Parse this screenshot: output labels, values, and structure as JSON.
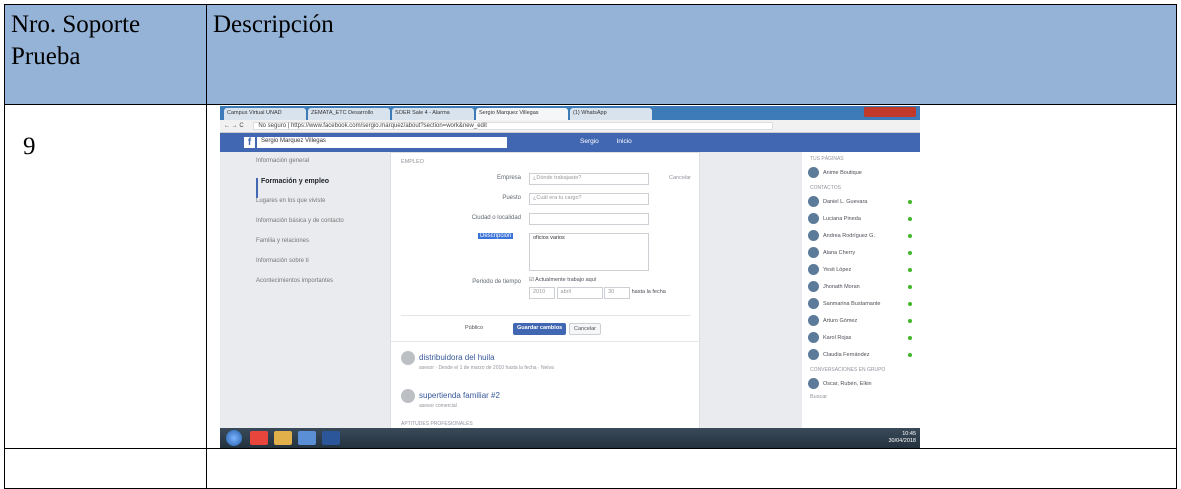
{
  "table": {
    "header_col1": "Nro. Soporte\nPrueba",
    "header_col2": "Descripción",
    "row_number": "9"
  },
  "screenshot": {
    "browser_tabs": [
      "Campus Virtual UNAD",
      "ZEMATA_ETC Desarrollo",
      "SOER Sale 4 - Alarma",
      "Sergio Marquez Villegas",
      "(1) WhatsApp"
    ],
    "address_security": "No seguro",
    "address_url": "https://www.facebook.com/sergio.marquez/about?section=work&new_edit",
    "search_value": "Sergio Marquez Villegas",
    "header_user": "Sergio",
    "header_inicio": "Inicio",
    "left_nav": [
      "Información general",
      "Formación y empleo",
      "Lugares en los que viviste",
      "Información básica y de contacto",
      "Familia y relaciones",
      "Información sobre ti",
      "Acontecimientos importantes"
    ],
    "section_label": "EMPLEO",
    "cancel_top": "Cancelar",
    "fields": {
      "empresa_label": "Empresa",
      "empresa_placeholder": "¿Dónde trabajaste?",
      "puesto_label": "Puesto",
      "puesto_placeholder": "¿Cuál era tu cargo?",
      "ciudad_label": "Ciudad o localidad",
      "descripcion_label": "Descripción",
      "descripcion_value": "oficios varios",
      "periodo_label": "Periodo de tiempo",
      "periodo_check": "Actualmente trabajo aquí",
      "periodo_year": "2010",
      "periodo_month": "abril",
      "periodo_day": "30",
      "periodo_end": "hasta la fecha"
    },
    "audience": "Público",
    "save_button": "Guardar cambios",
    "cancel_button": "Cancelar",
    "work_items": [
      {
        "title": "distribuidora del huila",
        "sub": "asesor · Desde el 1 de marzo de 2010 hasta la fecha · Neiva"
      },
      {
        "title": "supertienda familiar #2",
        "sub": "asesor comercial"
      }
    ],
    "more_label": "APTITUDES PROFESIONALES",
    "right_sidebar": {
      "pages_header": "TUS PÁGINAS",
      "page_item": "Anime Boutique",
      "contacts_header": "CONTACTOS",
      "contacts": [
        "Daniel L. Guevara",
        "Luciana Pineda",
        "Andrea Rodríguez G.",
        "Alana Cherry",
        "Yesit López",
        "Jhonath Moran",
        "Sanmarina Bustamante",
        "Arturo Gómez",
        "Karol Rojas",
        "Claudia Fernández"
      ],
      "groups_header": "CONVERSACIONES EN GRUPO",
      "group_item": "Oscar, Rubén, Elkin",
      "search_placeholder": "Buscar"
    },
    "clock_time": "10:45",
    "clock_date": "30/04/2018"
  }
}
